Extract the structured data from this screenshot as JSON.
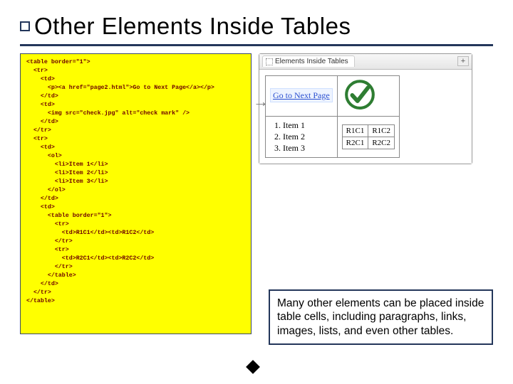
{
  "title": "Other Elements Inside Tables",
  "code": "<table border=\"1\">\n  <tr>\n    <td>\n      <p><a href=\"page2.html\">Go to Next Page</a></p>\n    </td>\n    <td>\n      <img src=\"check.jpg\" alt=\"check mark\" />\n    </td>\n  </tr>\n  <tr>\n    <td>\n      <ol>\n        <li>Item 1</li>\n        <li>Item 2</li>\n        <li>Item 3</li>\n      </ol>\n    </td>\n    <td>\n      <table border=\"1\">\n        <tr>\n          <td>R1C1</td><td>R1C2</td>\n        </tr>\n        <tr>\n          <td>R2C1</td><td>R2C2</td>\n        </tr>\n      </table>\n    </td>\n  </tr>\n</table>",
  "browser": {
    "tab_title": "Elements Inside Tables",
    "newtab": "+"
  },
  "rendered": {
    "link_text": "Go to Next Page",
    "list": [
      "Item 1",
      "Item 2",
      "Item 3"
    ],
    "inner": [
      [
        "R1C1",
        "R1C2"
      ],
      [
        "R2C1",
        "R2C2"
      ]
    ]
  },
  "caption": "Many other elements can be placed inside table cells, including paragraphs, links, images, lists, and even other tables."
}
